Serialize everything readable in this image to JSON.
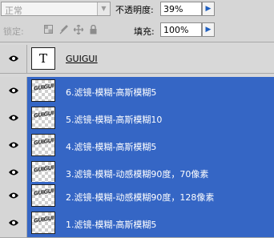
{
  "toolbar1": {
    "blend_mode": "正常",
    "opacity_label": "不透明度:",
    "opacity_value": "39%"
  },
  "toolbar2": {
    "lock_label": "锁定:",
    "fill_label": "填充:",
    "fill_value": "100%"
  },
  "layers": [
    {
      "name": "GUIGUI",
      "thumb": "T",
      "selected": false
    },
    {
      "name": "6.滤镜-模糊-高斯模糊5",
      "thumb_text": "GUIGUI",
      "selected": true
    },
    {
      "name": "5.滤镜-模糊-高斯模糊10",
      "thumb_text": "GUIGUI",
      "selected": true
    },
    {
      "name": "4.滤镜-模糊-高斯模糊5",
      "thumb_text": "GUIGUI",
      "selected": true
    },
    {
      "name": "3.滤镜-模糊-动感模糊90度，70像素",
      "thumb_text": "GUIGUI",
      "selected": true
    },
    {
      "name": "2.滤镜-模糊-动感模糊90度，128像素",
      "thumb_text": "GUIGUI",
      "selected": true
    },
    {
      "name": "1.滤镜-模糊-高斯模糊5",
      "thumb_text": "GUIGUI",
      "selected": true
    }
  ],
  "colors": {
    "selection": "#3566c5",
    "panel": "#d6d6d6"
  }
}
